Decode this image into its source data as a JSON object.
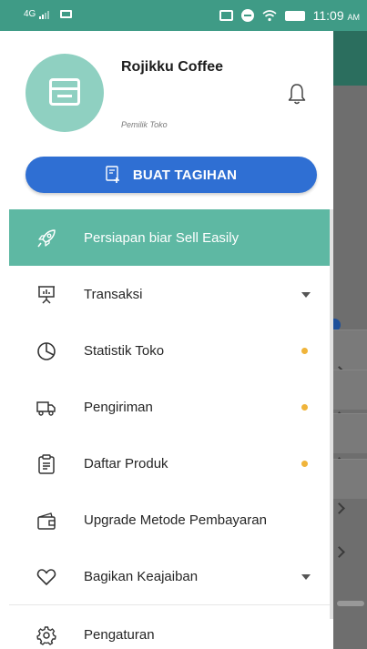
{
  "status_bar": {
    "network": "4G",
    "time": "11:09",
    "time_suffix": "AM"
  },
  "profile": {
    "store_name": "Rojikku Coffee",
    "role": "Pemilik Toko"
  },
  "cta": {
    "label": "BUAT TAGIHAN"
  },
  "menu": {
    "items": [
      {
        "label": "Persiapan biar Sell Easily",
        "icon": "rocket-icon",
        "active": true
      },
      {
        "label": "Transaksi",
        "icon": "presentation-icon",
        "trailing": "caret"
      },
      {
        "label": "Statistik Toko",
        "icon": "pie-chart-icon",
        "trailing": "dot"
      },
      {
        "label": "Pengiriman",
        "icon": "truck-icon",
        "trailing": "dot"
      },
      {
        "label": "Daftar Produk",
        "icon": "clipboard-icon",
        "trailing": "dot"
      },
      {
        "label": "Upgrade Metode Pembayaran",
        "icon": "wallet-icon"
      },
      {
        "label": "Bagikan Keajaiban",
        "icon": "heart-icon",
        "trailing": "caret"
      },
      {
        "label": "Pengaturan",
        "icon": "gear-icon"
      }
    ]
  },
  "colors": {
    "primary_teal": "#5eb8a3",
    "cta_blue": "#2f6fd3",
    "indicator_dot": "#f0b43a"
  }
}
